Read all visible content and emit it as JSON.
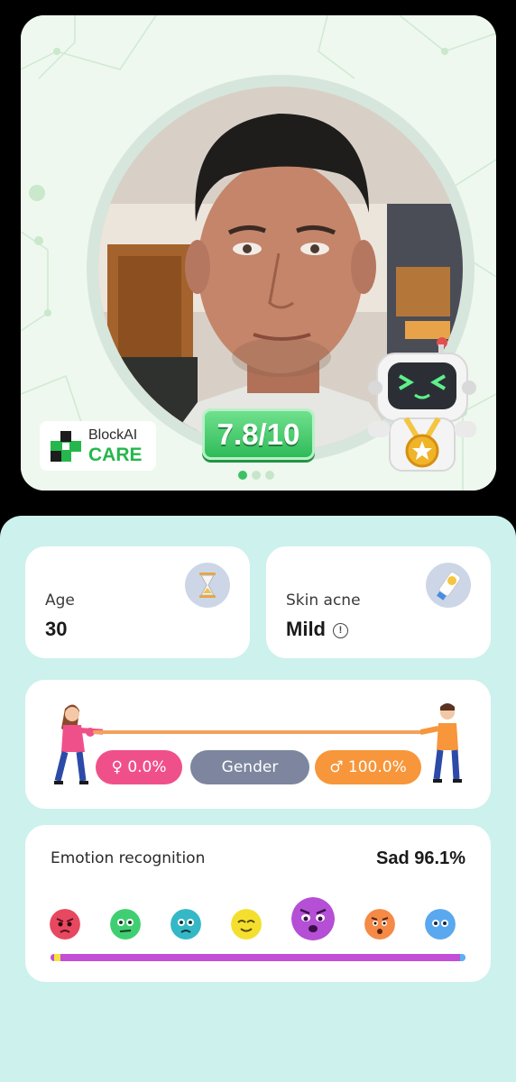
{
  "hero": {
    "brand": {
      "top": "BlockAI",
      "bottom": "CARE"
    },
    "score": "7.8/10",
    "carousel": {
      "count": 3,
      "active": 0
    }
  },
  "stats": {
    "age": {
      "label": "Age",
      "value": "30",
      "icon": "hourglass-icon"
    },
    "acne": {
      "label": "Skin acne",
      "value": "Mild",
      "icon": "sunscreen-tube-icon",
      "info_glyph": "!"
    }
  },
  "gender": {
    "label": "Gender",
    "female": "♀ 0.0%",
    "male": "♂ 100.0%",
    "colors": {
      "female": "#f0508a",
      "neutral": "#7d869e",
      "male": "#f7963a",
      "rope": "#f2a25c"
    }
  },
  "emotion": {
    "title": "Emotion recognition",
    "result": "Sad 96.1%",
    "faces": [
      {
        "name": "angry",
        "color": "#e8485f"
      },
      {
        "name": "disgust",
        "color": "#3fcf72"
      },
      {
        "name": "fear",
        "color": "#35b8c6"
      },
      {
        "name": "happy",
        "color": "#f5df2e"
      },
      {
        "name": "sad",
        "color": "#b54fd6",
        "active": true
      },
      {
        "name": "surprise",
        "color": "#f58a47"
      },
      {
        "name": "neutral",
        "color": "#5aa8ee"
      }
    ],
    "bar_color": "#c24fd6"
  }
}
